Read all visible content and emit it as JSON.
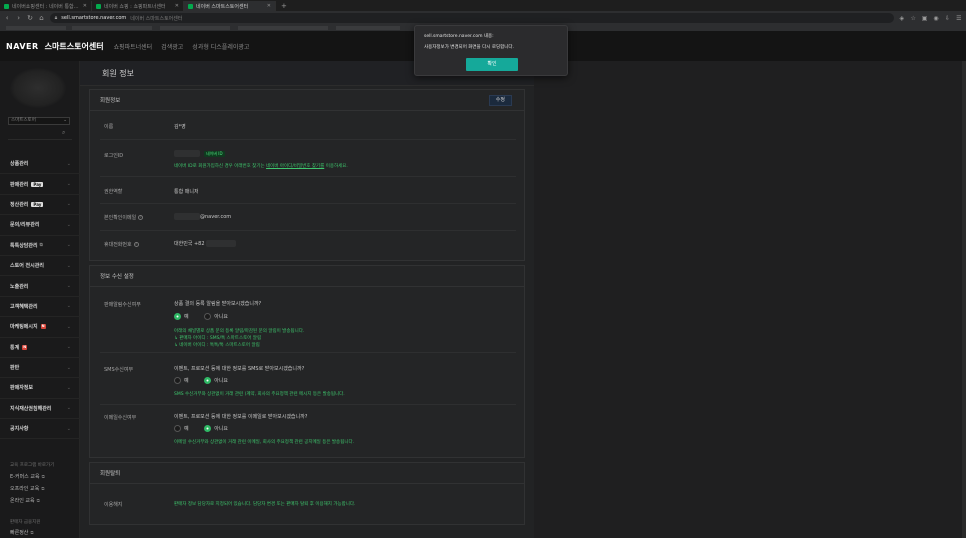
{
  "browser": {
    "tabs": [
      {
        "title": "네이버쇼핑센터 : 네이버 통합검색",
        "active": false
      },
      {
        "title": "네이버 쇼핑 : 쇼핑파트너센터",
        "active": false
      },
      {
        "title": "네이버 스마트스토어센터",
        "active": true
      }
    ],
    "url": "sell.smartstore.naver.com",
    "url_suffix": "네이버 스마트스토어센터"
  },
  "header": {
    "brand": "NAVER",
    "product": "스마트스토어센터",
    "menu": [
      "쇼핑파트너센터",
      "검색광고",
      "성과형 디스플레이광고"
    ]
  },
  "sidebar": {
    "store_select": "스마트스토어",
    "items": [
      {
        "label": "상품관리",
        "pay": false,
        "badge": false
      },
      {
        "label": "판매관리",
        "pay": true,
        "badge": false
      },
      {
        "label": "정산관리",
        "pay": true,
        "badge": false
      },
      {
        "label": "문의/리뷰관리",
        "pay": false,
        "badge": false
      },
      {
        "label": "톡톡상담관리",
        "pay": false,
        "badge": false
      },
      {
        "label": "스토어 전시관리",
        "pay": false,
        "badge": false
      },
      {
        "label": "노출관리",
        "pay": false,
        "badge": false
      },
      {
        "label": "고객혜택관리",
        "pay": false,
        "badge": false
      },
      {
        "label": "마케팅메시지",
        "pay": false,
        "badge": true
      },
      {
        "label": "통계",
        "pay": false,
        "badge": true
      },
      {
        "label": "판반",
        "pay": false,
        "badge": false
      },
      {
        "label": "판매자정보",
        "pay": false,
        "badge": false
      },
      {
        "label": "지식재산권침해관리",
        "pay": false,
        "badge": false
      },
      {
        "label": "공지사항",
        "pay": false,
        "badge": false
      }
    ],
    "pay_label": "Pay",
    "badge_label": "N",
    "section1_title": "교육 프로그램 바로가기",
    "section1_links": [
      "E-커머스 교육",
      "오프라인 교육",
      "온라인 교육"
    ],
    "section2_title": "판매자 금융지원",
    "section2_links": [
      "빠른정산"
    ]
  },
  "main": {
    "page_title": "회원 정보",
    "member": {
      "title": "회원정보",
      "edit_label": "수정",
      "name_label": "이름",
      "name_value": "김*영",
      "login_label": "로그인ID",
      "naver_id_tag": "네이버 ID",
      "login_help": "네이버 ID로 회원가입하신 경우 아래번호 찾기는",
      "login_help_link": "네이버 아이디/비밀번호 찾기를",
      "login_help_tail": "이용하세요.",
      "role_label": "권한역할",
      "role_value": "통합 매니저",
      "email_label": "본인확인이메일",
      "email_domain": "@naver.com",
      "phone_label": "휴대전화번호",
      "phone_value": "대한민국 +82"
    },
    "notify": {
      "title": "정보 수신 설정",
      "talk_label": "판매알림수신여부",
      "talk_question": "상품 결의 등록 알림을 받아보시겠습니까?",
      "yes": "예",
      "no": "아니요",
      "talk_desc": "아래의 채널별로 상품 문의 등록 알림/마감된 문의 알림이 발송됩니다.",
      "talk_channel1": "판매자 아이디 : SMS/톡 스마트스토어 알림",
      "talk_channel2": "네이버 아이디 : 톡톡/톡 스마트스토어 알림",
      "sms_label": "SMS수신여부",
      "sms_question": "이벤트, 프로모션 등에 대한 정보를 SMS로 받아보시겠습니까?",
      "sms_desc": "SMS 수신거부와 상관없이 거래 관련 (계약, 회사의 주요정책 관련 메시지 등은 발송됩니다.",
      "email_label": "이메일수신여부",
      "email_question": "이벤트, 프로모션 등에 대한 정보를 이메일로 받아보시겠습니까?",
      "email_desc": "이메일 수신거부와 상관없이 거래 관련 이메일, 회사의 주요정책 관련 공지메일 등은 발송됩니다."
    },
    "withdraw": {
      "title": "회원탈퇴",
      "label": "이용해지",
      "desc": "판매자 정보 담당자로 지정되어 있습니다. 담당자 변경 또는 판매자 탈퇴 후 이용해지 가능합니다."
    }
  },
  "dialog": {
    "origin": "sell.smartstore.naver.com 내용:",
    "message": "사용자정보가 변경되어 화면을 다시 로딩합니다.",
    "ok_label": "확인"
  }
}
